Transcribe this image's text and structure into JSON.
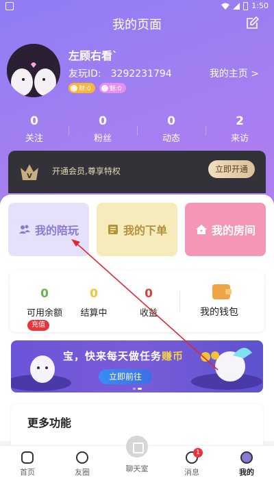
{
  "status_bar": {
    "time": "1:50"
  },
  "header": {
    "title": "我的页面"
  },
  "profile": {
    "name": "左顾右看`",
    "uid_label": "友玩ID:",
    "uid": "3292231794",
    "homepage_link": "我的主页 >",
    "badges": [
      {
        "label": "财:0",
        "color": "#f7b53a"
      },
      {
        "label": "魅:0",
        "color": "#e68ff0"
      }
    ]
  },
  "stats": [
    {
      "value": "0",
      "label": "关注"
    },
    {
      "value": "0",
      "label": "粉丝"
    },
    {
      "value": "0",
      "label": "动态"
    },
    {
      "value": "2",
      "label": "来访"
    }
  ],
  "vip": {
    "text": "开通会员,尊享特权",
    "button": "立即开通"
  },
  "feature_cards": [
    {
      "label": "我的陪玩",
      "icon": "users-icon"
    },
    {
      "label": "我的下单",
      "icon": "order-icon"
    },
    {
      "label": "我的房间",
      "icon": "house-icon"
    }
  ],
  "wallet": {
    "balance": {
      "value": "0",
      "label": "可用余额"
    },
    "pending": {
      "value": "0",
      "label": "结算中"
    },
    "income": {
      "value": "0",
      "label": "收益"
    },
    "recharge_label": "充值",
    "wallet_label": "我的钱包"
  },
  "banner": {
    "text_main": "宝，快来每天做任务",
    "text_highlight": "赚币",
    "button": "立即前往"
  },
  "more": {
    "title": "更多功能"
  },
  "tabbar": [
    {
      "label": "首页"
    },
    {
      "label": "友圈"
    },
    {
      "label": "聊天室"
    },
    {
      "label": "消息",
      "badge": "1"
    },
    {
      "label": "我的"
    }
  ],
  "colors": {
    "accent": "#9a7ef2",
    "vip_bg": "#333239",
    "alert": "#e8353d"
  }
}
